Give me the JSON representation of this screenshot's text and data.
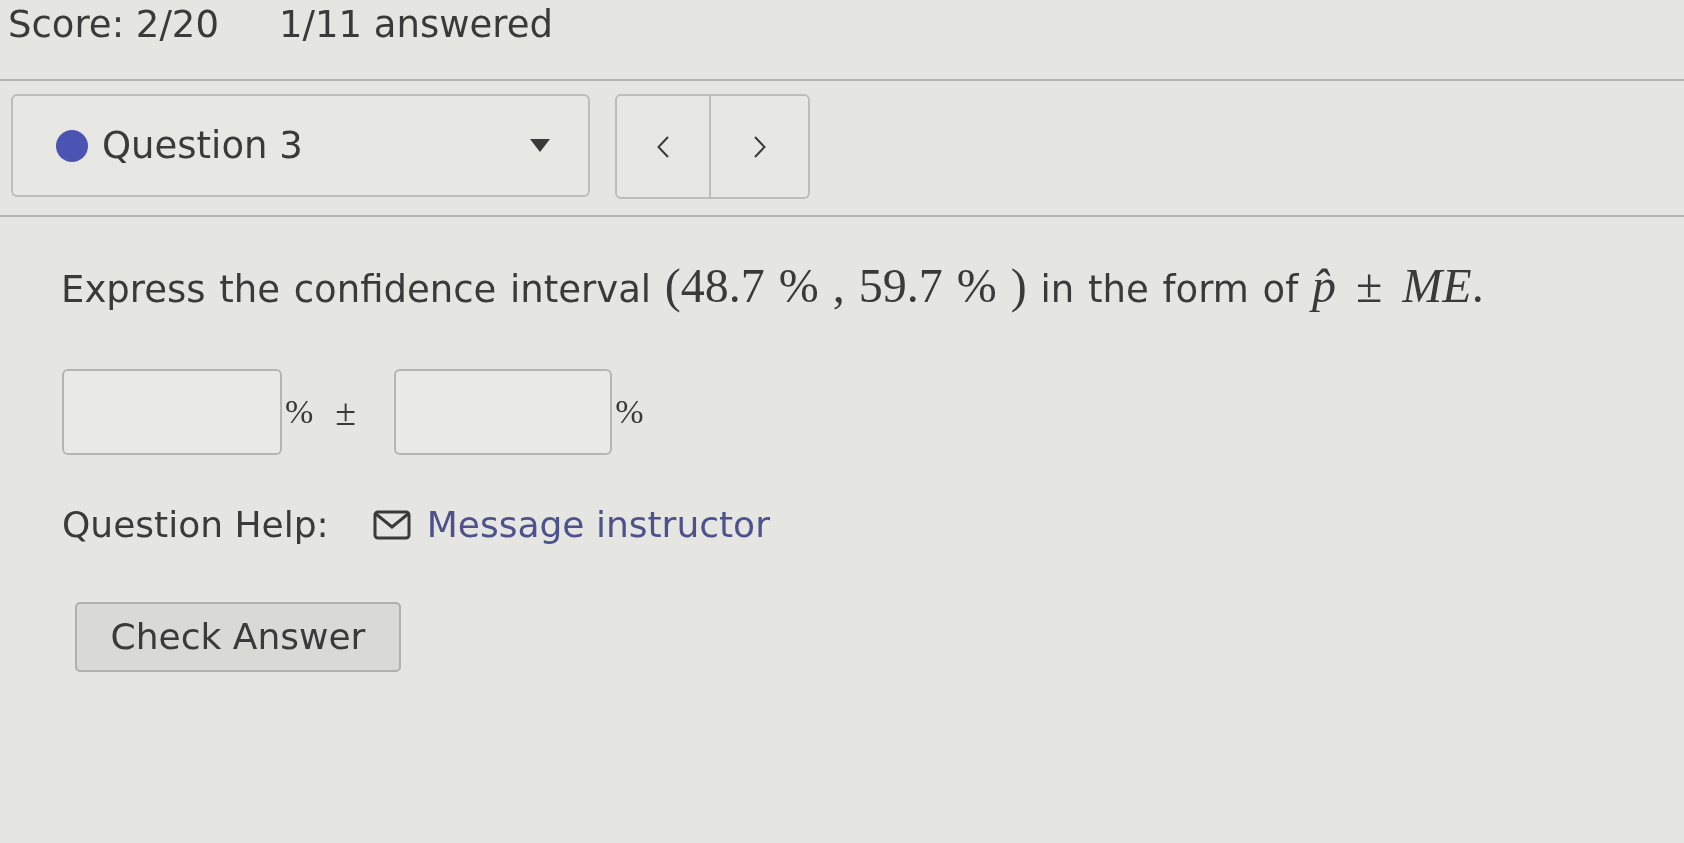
{
  "header": {
    "score": "Score: 2/20",
    "progress": "1/11 answered"
  },
  "question_nav": {
    "question_select": {
      "label": "Question 3",
      "color": "#4b53b3"
    }
  },
  "question": {
    "prompt_before": "Express the confidence interval",
    "interval": "(48.7 % , 59.7 % )",
    "prompt_middle": "in the form of",
    "expression": "*p̂* ± *ME*."
  },
  "answer": {
    "unit_1": "%",
    "operator": "±",
    "unit_2": "%"
  },
  "help": {
    "label": "Question Help:",
    "link": "Message instructor"
  },
  "check_button": "Check Answer"
}
